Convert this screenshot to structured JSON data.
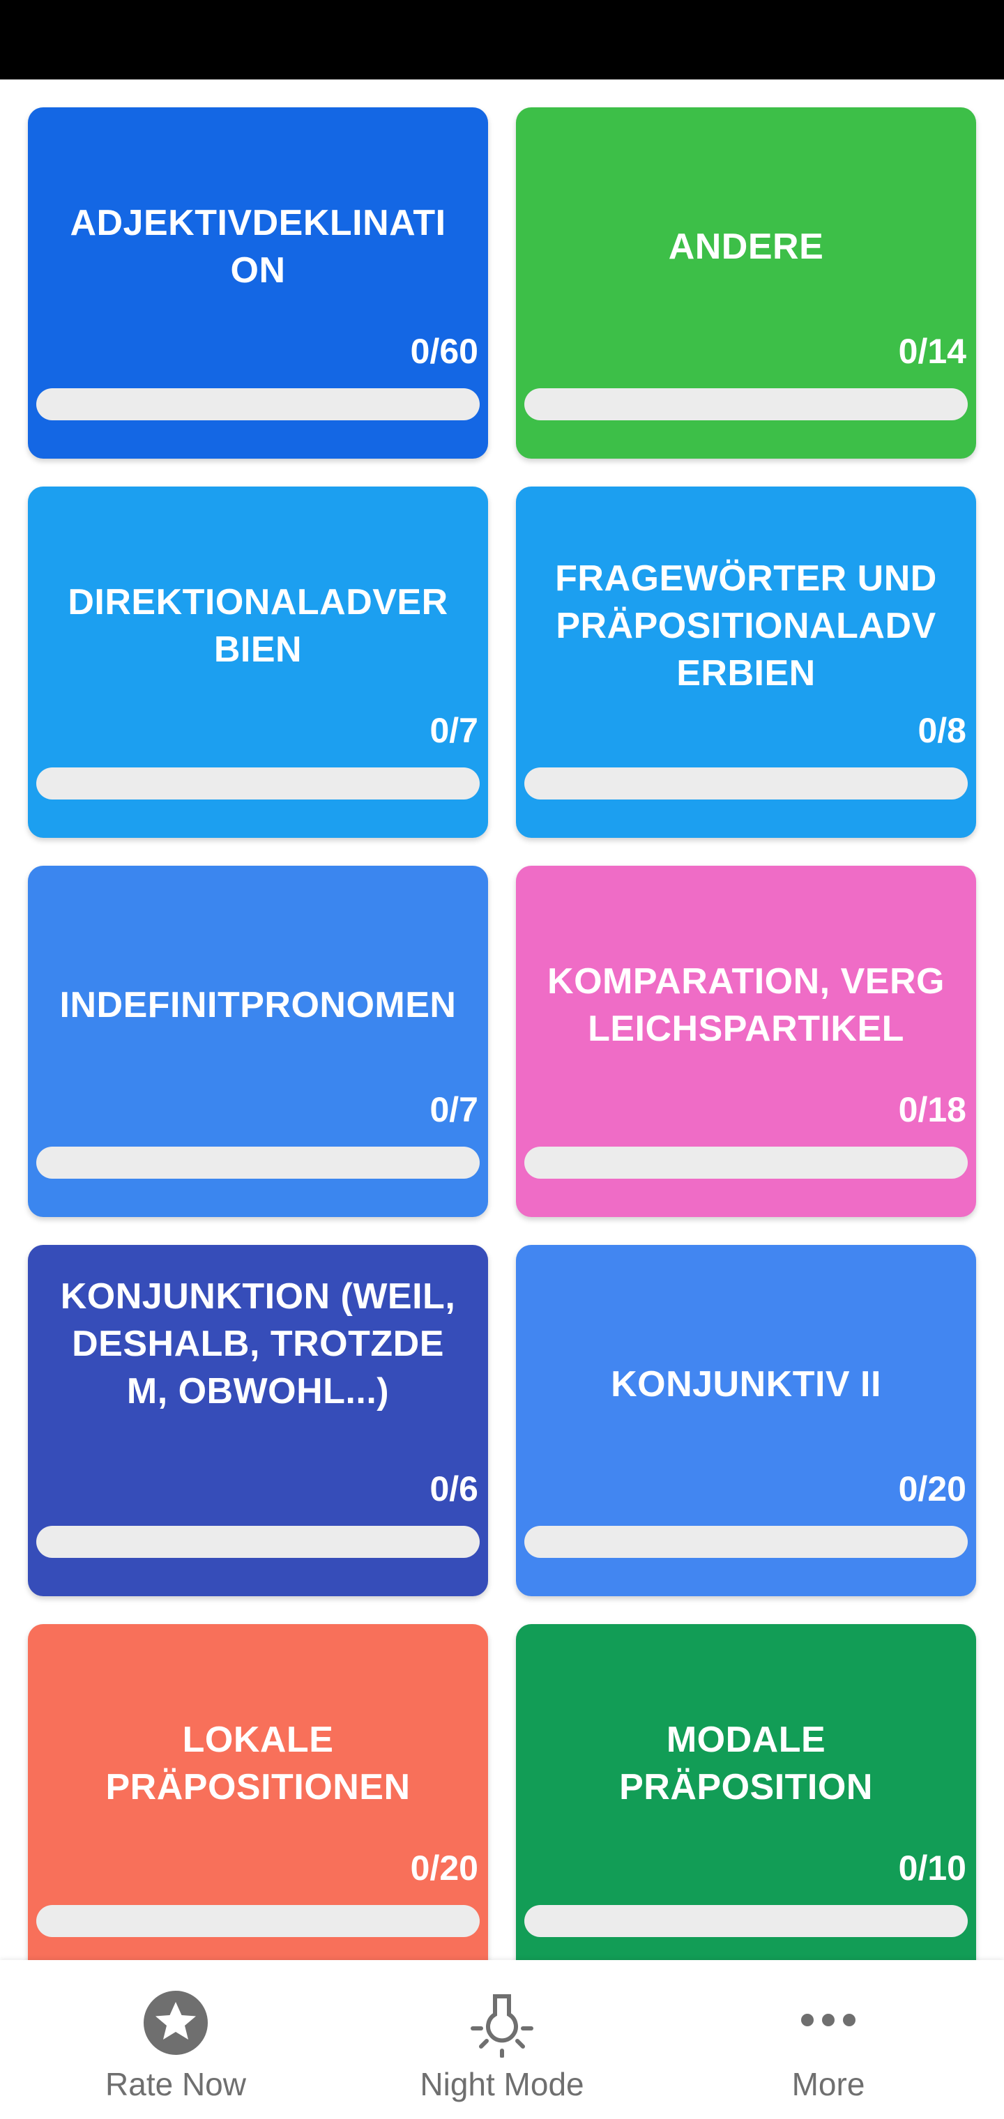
{
  "colors": {
    "status_bar": "#000000",
    "progress_track": "#ececec",
    "nav_icon": "#6f6f6f",
    "nav_label": "#6f6f6f"
  },
  "cards": [
    {
      "title": "ADJEKTIVDEKLINATION",
      "count": "0/60",
      "progress": 0,
      "color": "#1467e4"
    },
    {
      "title": "ANDERE",
      "count": "0/14",
      "progress": 0,
      "color": "#3dbf48"
    },
    {
      "title": "DIREKTIONALADVERBIEN",
      "count": "0/7",
      "progress": 0,
      "color": "#1c9ff0"
    },
    {
      "title": "FRAGEWÖRTER UND PRÄPOSITIONALADVERBIEN",
      "count": "0/8",
      "progress": 0,
      "color": "#1c9ff0"
    },
    {
      "title": "INDEFINITPRONOMEN",
      "count": "0/7",
      "progress": 0,
      "color": "#3b86ef"
    },
    {
      "title": "KOMPARATION, VERGLEICHSPARTIKEL",
      "count": "0/18",
      "progress": 0,
      "color": "#ef6cc6"
    },
    {
      "title": "KONJUNKTION (WEIL, DESHALB, TROTZDEM, OBWOHL...)",
      "count": "0/6",
      "progress": 0,
      "color": "#364db9"
    },
    {
      "title": "KONJUNKTIV II",
      "count": "0/20",
      "progress": 0,
      "color": "#4286f1"
    },
    {
      "title": "LOKALE PRÄPOSITIONEN",
      "count": "0/20",
      "progress": 0,
      "color": "#f8705a"
    },
    {
      "title": "MODALE PRÄPOSITION",
      "count": "0/10",
      "progress": 0,
      "color": "#129d56"
    }
  ],
  "bottom_nav": [
    {
      "label": "Rate Now",
      "icon": "star-circle-icon"
    },
    {
      "label": "Night Mode",
      "icon": "lightbulb-icon"
    },
    {
      "label": "More",
      "icon": "more-dots-icon"
    }
  ]
}
